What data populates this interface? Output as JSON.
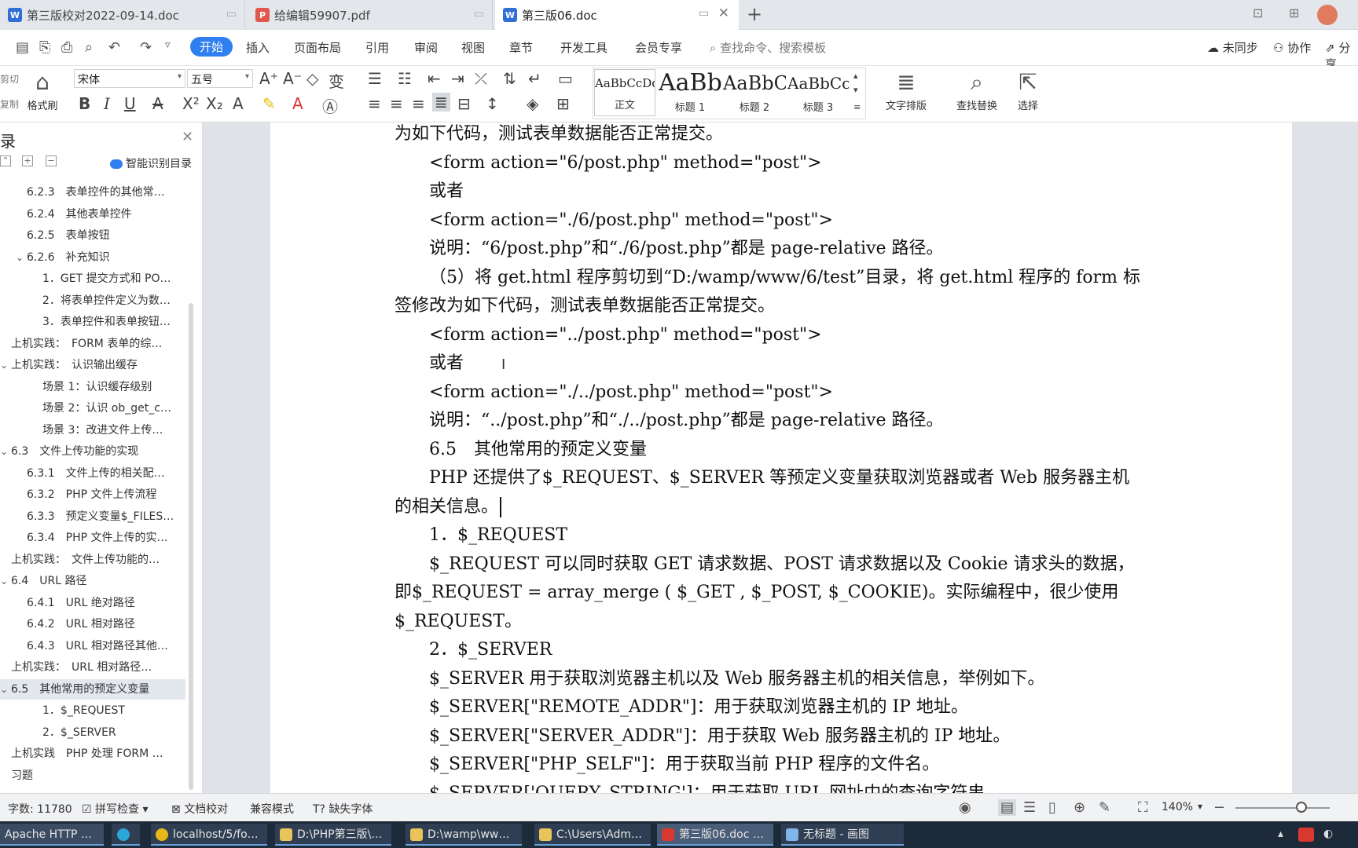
{
  "tabs": [
    {
      "label": "第三版校对2022-09-14.doc",
      "type": "word",
      "active": false
    },
    {
      "label": "给编辑59907.pdf",
      "type": "pdf",
      "active": false
    },
    {
      "label": "第三版06.doc",
      "type": "word",
      "active": true
    }
  ],
  "new_tab_label": "+",
  "menu": {
    "items": [
      "开始",
      "插入",
      "页面布局",
      "引用",
      "审阅",
      "视图",
      "章节",
      "开发工具",
      "会员专享"
    ],
    "active": "开始",
    "search_placeholder": "查找命令、搜索模板",
    "right": [
      "未同步",
      "协作",
      "分享"
    ]
  },
  "ribbon": {
    "cut_label": "剪切",
    "copy_label": "复制",
    "format_painter_label": "格式刷",
    "font_name": "宋体",
    "font_size": "五号",
    "styles": [
      {
        "sample": "AaBbCcDd",
        "label": "正文"
      },
      {
        "sample": "AaBb",
        "label": "标题 1"
      },
      {
        "sample": "AaBbC",
        "label": "标题 2"
      },
      {
        "sample": "AaBbCcD",
        "label": "标题 3"
      }
    ],
    "text_layout_label": "文字排版",
    "find_replace_label": "查找替换",
    "select_label": "选择"
  },
  "nav": {
    "title": "录",
    "smart_toc_label": "智能识别目录",
    "items": [
      {
        "text": "6.2.3　表单控件的其他常…",
        "level": 2,
        "caret": false,
        "selected": false
      },
      {
        "text": "6.2.4　其他表单控件",
        "level": 2,
        "caret": false,
        "selected": false
      },
      {
        "text": "6.2.5　表单按钮",
        "level": 2,
        "caret": false,
        "selected": false
      },
      {
        "text": "6.2.6　补充知识",
        "level": 2,
        "caret": true,
        "selected": false
      },
      {
        "text": "1．GET 提交方式和 PO…",
        "level": 3,
        "caret": false,
        "selected": false
      },
      {
        "text": "2．将表单控件定义为数…",
        "level": 3,
        "caret": false,
        "selected": false
      },
      {
        "text": "3．表单控件和表单按钮…",
        "level": 3,
        "caret": false,
        "selected": false
      },
      {
        "text": "上机实践：　FORM 表单的综…",
        "level": 1,
        "caret": false,
        "selected": false
      },
      {
        "text": "上机实践：　认识输出缓存",
        "level": 1,
        "caret": true,
        "selected": false
      },
      {
        "text": "场景 1：认识缓存级别",
        "level": 3,
        "caret": false,
        "selected": false
      },
      {
        "text": "场景 2：认识 ob_get_c…",
        "level": 3,
        "caret": false,
        "selected": false
      },
      {
        "text": "场景 3：改进文件上传…",
        "level": 3,
        "caret": false,
        "selected": false
      },
      {
        "text": "6.3　文件上传功能的实现",
        "level": 1,
        "caret": true,
        "selected": false
      },
      {
        "text": "6.3.1　文件上传的相关配…",
        "level": 2,
        "caret": false,
        "selected": false
      },
      {
        "text": "6.3.2　PHP 文件上传流程",
        "level": 2,
        "caret": false,
        "selected": false
      },
      {
        "text": "6.3.3　预定义变量$_FILES…",
        "level": 2,
        "caret": false,
        "selected": false
      },
      {
        "text": "6.3.4　PHP 文件上传的实…",
        "level": 2,
        "caret": false,
        "selected": false
      },
      {
        "text": "上机实践：　文件上传功能的…",
        "level": 1,
        "caret": false,
        "selected": false
      },
      {
        "text": "6.4　URL 路径",
        "level": 1,
        "caret": true,
        "selected": false
      },
      {
        "text": "6.4.1　URL 绝对路径",
        "level": 2,
        "caret": false,
        "selected": false
      },
      {
        "text": "6.4.2　URL 相对路径",
        "level": 2,
        "caret": false,
        "selected": false
      },
      {
        "text": "6.4.3　URL 相对路径其他…",
        "level": 2,
        "caret": false,
        "selected": false
      },
      {
        "text": "上机实践：　URL 相对路径…",
        "level": 1,
        "caret": false,
        "selected": false
      },
      {
        "text": "6.5　其他常用的预定义变量",
        "level": 1,
        "caret": true,
        "selected": true
      },
      {
        "text": "1．$_REQUEST",
        "level": 3,
        "caret": false,
        "selected": false
      },
      {
        "text": "2．$_SERVER",
        "level": 3,
        "caret": false,
        "selected": false
      },
      {
        "text": "上机实践　PHP 处理 FORM …",
        "level": 1,
        "caret": false,
        "selected": false
      },
      {
        "text": "习题",
        "level": 1,
        "caret": false,
        "selected": false
      }
    ]
  },
  "document": {
    "lines": [
      "为如下代码，测试表单数据能否正常提交。",
      "<form action=\"6/post.php\" method=\"post\">",
      "或者",
      "<form action=\"./6/post.php\" method=\"post\">",
      "说明：“6/post.php”和“./6/post.php”都是 page-relative 路径。",
      "（5）将 get.html 程序剪切到“D:/wamp/www/6/test”目录，将 get.html 程序的 form 标",
      "签修改为如下代码，测试表单数据能否正常提交。",
      "<form action=\"../post.php\" method=\"post\">",
      "或者",
      "<form action=\"./../post.php\" method=\"post\">",
      "说明：“../post.php”和“./../post.php”都是 page-relative 路径。",
      "6.5　其他常用的预定义变量",
      "PHP 还提供了$_REQUEST、$_SERVER 等预定义变量获取浏览器或者 Web 服务器主机",
      "的相关信息。",
      "1．$_REQUEST",
      "$_REQUEST 可以同时获取 GET 请求数据、POST 请求数据以及 Cookie 请求头的数据，",
      "即$_REQUEST = array_merge ( $_GET , $_POST, $_COOKIE)。实际编程中，很少使用",
      "$_REQUEST。",
      "2．$_SERVER",
      "$_SERVER 用于获取浏览器主机以及 Web 服务器主机的相关信息，举例如下。",
      "$_SERVER[\"REMOTE_ADDR\"]：用于获取浏览器主机的 IP 地址。",
      "$_SERVER[\"SERVER_ADDR\"]：用于获取 Web 服务器主机的 IP 地址。",
      "$_SERVER[\"PHP_SELF\"]：用于获取当前 PHP 程序的文件名。",
      "$_SERVER['QUERY_STRING']：用于获取 URL 网址中的查询字符串"
    ]
  },
  "status": {
    "word_count": "字数: 11780",
    "spell_check": "拼写检查",
    "doc_proof": "文档校对",
    "compat_mode": "兼容模式",
    "missing_font": "缺失字体",
    "zoom": "140%",
    "zoom_level": 0.7
  },
  "taskbar": [
    {
      "label": "Apache HTTP …"
    },
    {
      "label": ""
    },
    {
      "label": "localhost/5/fo…"
    },
    {
      "label": "D:\\PHP第三版\\…"
    },
    {
      "label": "D:\\wamp\\ww…"
    },
    {
      "label": "C:\\Users\\Adm…"
    },
    {
      "label": "第三版06.doc …"
    },
    {
      "label": "无标题 - 画图"
    }
  ],
  "colors": {
    "accent": "#2f7ff0",
    "taskbar": "#1d2a3a",
    "wps_red": "#d9382e"
  }
}
